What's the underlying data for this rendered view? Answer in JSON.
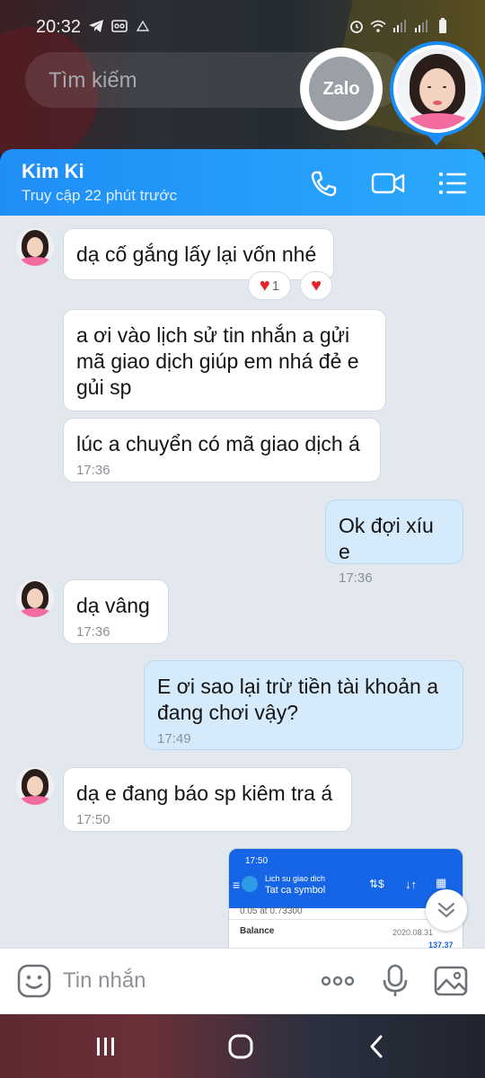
{
  "status_bar": {
    "time": "20:32"
  },
  "search": {
    "placeholder": "Tìm kiếm"
  },
  "zalo_bubble": {
    "label": "Zalo"
  },
  "header": {
    "contact_name": "Kim Ki",
    "last_seen": "Truy cập 22 phút trước"
  },
  "messages": [
    {
      "from": "contact",
      "text": "dạ cố gắng lấy lại vốn nhé",
      "time": ""
    },
    {
      "from": "contact",
      "text": "a ơi vào lịch sử tin nhắn a gửi\nmã giao dịch giúp em nhá đẻ e\ngủi sp",
      "time": ""
    },
    {
      "from": "contact",
      "text": "lúc a chuyển có mã giao dịch á",
      "time": "17:36"
    },
    {
      "from": "me",
      "text": "Ok đợi xíu e",
      "time": "17:36"
    },
    {
      "from": "contact",
      "text": "dạ vâng",
      "time": "17:36"
    },
    {
      "from": "me",
      "text": "E ơi sao lại trừ tiền tài khoản a\nđang chơi vậy?",
      "time": "17:49"
    },
    {
      "from": "contact",
      "text": "dạ e đang báo sp kiêm tra á",
      "time": "17:50"
    }
  ],
  "reactions": {
    "heart_count": "1"
  },
  "image_message": {
    "time": "17:50",
    "title": "Lich su giao dich",
    "subtitle": "Tat ca symbol",
    "row_partial": "0.05 at 0.73300",
    "label": "Balance",
    "date": "2020.08.31",
    "amount": "137.37"
  },
  "input": {
    "placeholder": "Tin nhắn"
  },
  "colors": {
    "header_start": "#1f8ef7",
    "header_end": "#2aa8fb",
    "chat_bg": "#e3e8ee",
    "sent_bubble": "#d5eafa",
    "heart": "#e5232c"
  }
}
